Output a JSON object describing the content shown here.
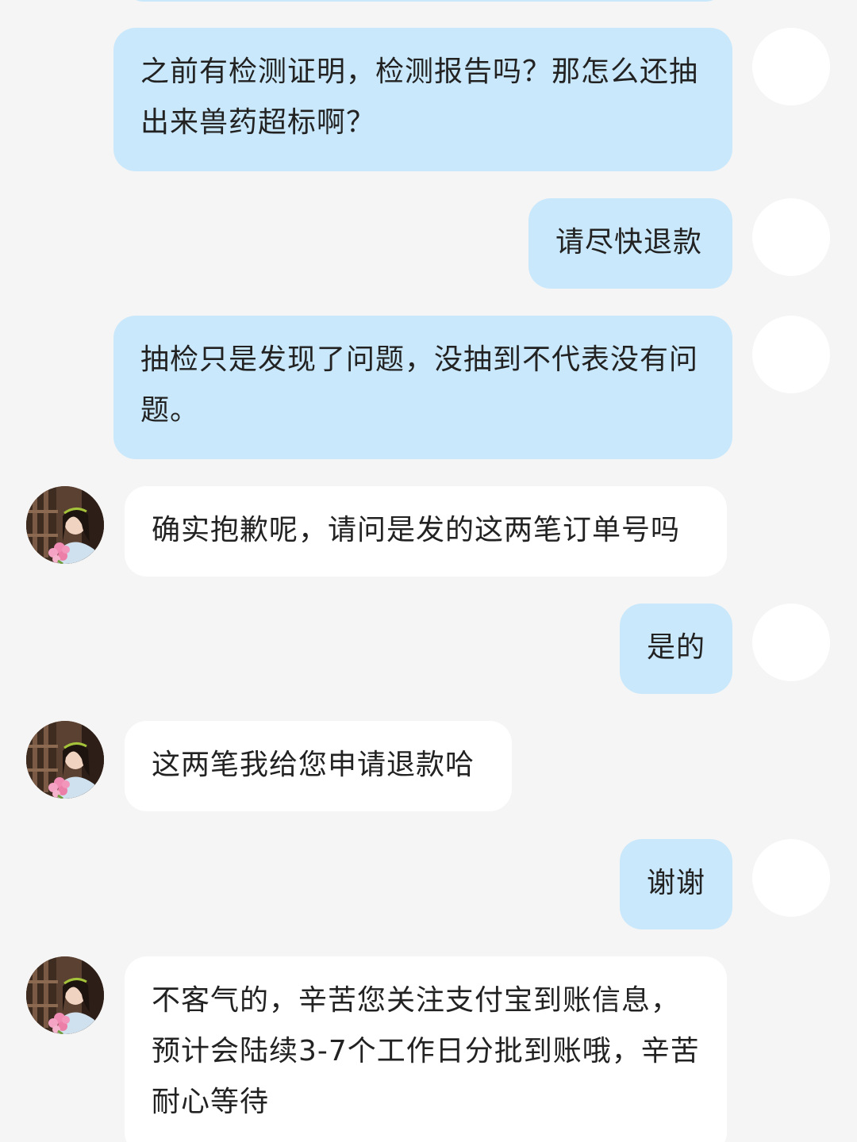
{
  "messages": [
    {
      "sender": "me",
      "text": "之前有检测证明，检测报告吗？那怎么还抽出来兽药超标啊？"
    },
    {
      "sender": "me",
      "text": "请尽快退款"
    },
    {
      "sender": "me",
      "text": "抽检只是发现了问题，没抽到不代表没有问题。"
    },
    {
      "sender": "them",
      "text": "确实抱歉呢，请问是发的这两笔订单号吗"
    },
    {
      "sender": "me",
      "text": "是的"
    },
    {
      "sender": "them",
      "text": "这两笔我给您申请退款哈"
    },
    {
      "sender": "me",
      "text": "谢谢"
    },
    {
      "sender": "them",
      "text": "不客气的，辛苦您关注支付宝到账信息，预计会陆续3-7个工作日分批到账哦，辛苦耐心等待"
    }
  ],
  "colors": {
    "background": "#f5f5f5",
    "my_bubble": "#cae8fb",
    "their_bubble": "#ffffff",
    "text": "#222222"
  }
}
